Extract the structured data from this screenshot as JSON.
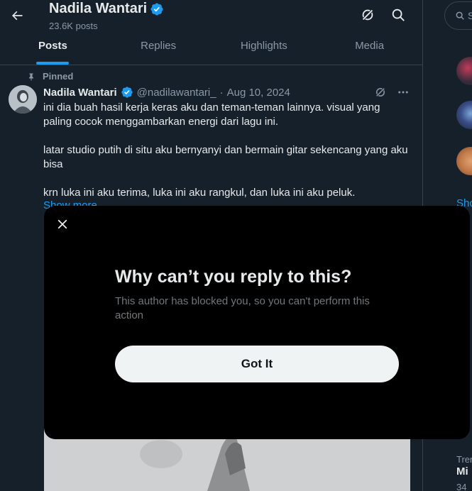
{
  "header": {
    "back_icon": "arrow-left-icon",
    "profile_name": "Nadila Wantari",
    "post_count": "23.6K posts",
    "grok_icon": "grok-icon",
    "search_icon": "search-icon"
  },
  "tabs": [
    {
      "label": "Posts",
      "active": true
    },
    {
      "label": "Replies",
      "active": false
    },
    {
      "label": "Highlights",
      "active": false
    },
    {
      "label": "Media",
      "active": false
    }
  ],
  "post": {
    "pinned_label": "Pinned",
    "author": "Nadila Wantari",
    "handle": "@nadilawantari_",
    "separator": "·",
    "date": "Aug 10, 2024",
    "paragraphs": [
      "ini dia buah hasil kerja keras aku dan teman-teman lainnya. visual yang paling cocok menggambarkan energi dari lagu ini.",
      "latar studio putih di situ aku bernyanyi dan bermain gitar sekencang yang aku bisa",
      "krn luka ini aku terima, luka ini aku rangkul, dan luka ini aku peluk."
    ],
    "show_more": "Show more"
  },
  "right_column": {
    "search_partial": "S",
    "show_partial": "Sho",
    "trend_label_partial": "Tren",
    "trend_title_partial": "Mi",
    "trend_count_partial": "34"
  },
  "modal": {
    "close_icon": "close-icon",
    "title": "Why can’t you reply to this?",
    "subtitle": "This author has blocked you, so you can't perform this action",
    "button_label": "Got It"
  },
  "colors": {
    "background": "#15202b",
    "accent": "#1d9bf0",
    "modal_bg": "#000000",
    "button_bg": "#eff3f4"
  }
}
